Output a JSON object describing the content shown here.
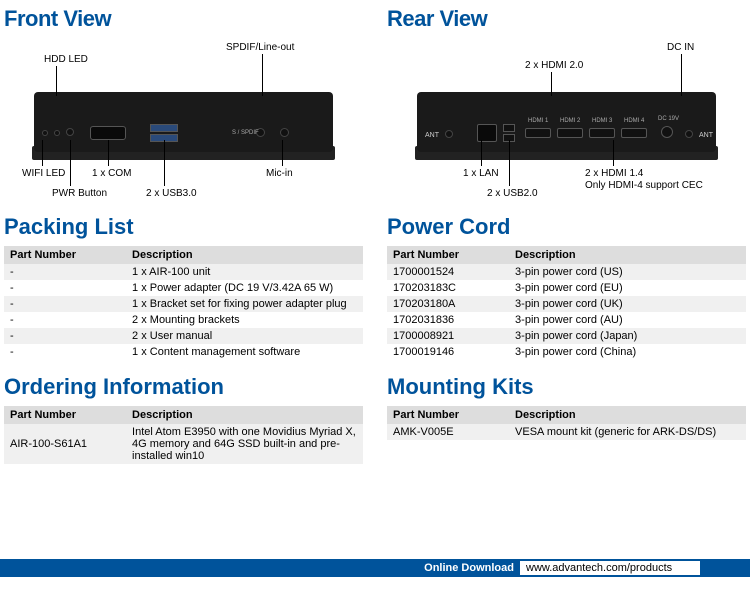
{
  "front": {
    "title": "Front View",
    "labels": {
      "hdd_led": "HDD LED",
      "spdif": "SPDIF/Line-out",
      "wifi_led": "WIFI LED",
      "com": "1 x COM",
      "mic": "Mic-in",
      "pwr": "PWR Button",
      "usb3": "2 x USB3.0"
    }
  },
  "rear": {
    "title": "Rear View",
    "labels": {
      "dcin": "DC IN",
      "hdmi20": "2 x HDMI 2.0",
      "lan": "1 x LAN",
      "hdmi14": "2 x HDMI 1.4",
      "hdmi14_note": "Only HDMI-4 support CEC",
      "usb2": "2 x USB2.0",
      "ant": "ANT"
    },
    "port_labels": {
      "hdmi1": "HDMI 1",
      "hdmi2": "HDMI 2",
      "hdmi3": "HDMI 3",
      "hdmi4": "HDMI 4",
      "dc": "DC 19V"
    }
  },
  "packing": {
    "title": "Packing List",
    "headers": {
      "pn": "Part Number",
      "desc": "Description"
    },
    "rows": [
      {
        "pn": "-",
        "desc": "1 x AIR-100 unit"
      },
      {
        "pn": "-",
        "desc": "1 x Power adapter (DC 19 V/3.42A 65 W)"
      },
      {
        "pn": "-",
        "desc": "1 x Bracket set for fixing power adapter plug"
      },
      {
        "pn": "-",
        "desc": "2 x Mounting brackets"
      },
      {
        "pn": "-",
        "desc": "2 x User manual"
      },
      {
        "pn": "-",
        "desc": "1 x Content management software"
      }
    ]
  },
  "powercord": {
    "title": "Power Cord",
    "headers": {
      "pn": "Part Number",
      "desc": "Description"
    },
    "rows": [
      {
        "pn": "1700001524",
        "desc": "3-pin power cord (US)"
      },
      {
        "pn": "170203183C",
        "desc": "3-pin power cord (EU)"
      },
      {
        "pn": "170203180A",
        "desc": "3-pin power cord (UK)"
      },
      {
        "pn": "1702031836",
        "desc": "3-pin power cord (AU)"
      },
      {
        "pn": "1700008921",
        "desc": "3-pin power cord (Japan)"
      },
      {
        "pn": "1700019146",
        "desc": "3-pin power cord (China)"
      }
    ]
  },
  "ordering": {
    "title": "Ordering Information",
    "headers": {
      "pn": "Part Number",
      "desc": "Description"
    },
    "rows": [
      {
        "pn": "AIR-100-S61A1",
        "desc": "Intel Atom E3950 with one Movidius Myriad X, 4G memory and 64G SSD built-in and pre-installed win10"
      }
    ]
  },
  "mounting": {
    "title": "Mounting Kits",
    "headers": {
      "pn": "Part Number",
      "desc": "Description"
    },
    "rows": [
      {
        "pn": "AMK-V005E",
        "desc": "VESA mount kit (generic for ARK-DS/DS)"
      }
    ]
  },
  "footer": {
    "dl": "Online Download",
    "url": "www.advantech.com/products"
  }
}
